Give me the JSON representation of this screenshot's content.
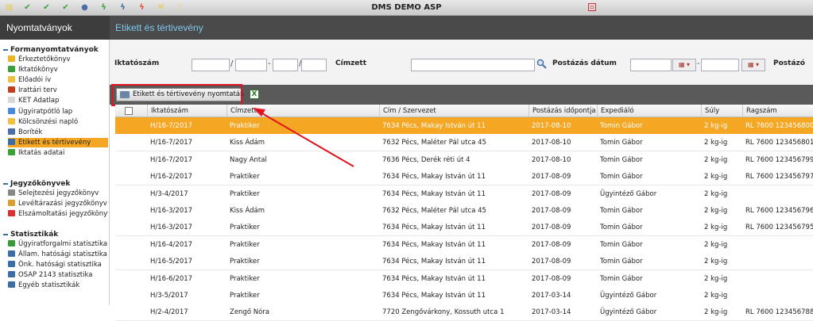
{
  "app_title": "DMS DEMO ASP",
  "sidebar_title": "Nyomtatványok",
  "page_title": "Etikett és tértivevény",
  "toolbar_icons": [
    "doc-icon",
    "check-icon",
    "check-icon",
    "check-icon",
    "user-icon",
    "lightning-icon",
    "lightning-icon",
    "lightning-icon",
    "mail-icon",
    "note-icon"
  ],
  "sections": [
    {
      "title": "Formanyomtatványok",
      "items": [
        {
          "label": "Érkeztetőkönyv",
          "icon": "book-icon",
          "color": "#f0b429"
        },
        {
          "label": "Iktatókönyv",
          "icon": "check-icon",
          "color": "#3aa03a"
        },
        {
          "label": "Előadói ív",
          "icon": "sheet-icon",
          "color": "#f0c040"
        },
        {
          "label": "Irattári terv",
          "icon": "plan-icon",
          "color": "#c04020"
        },
        {
          "label": "KET Adatlap",
          "icon": "form-icon",
          "color": "#d8d8d8"
        },
        {
          "label": "Ügyiratpótló lap",
          "icon": "page-icon",
          "color": "#4a8ad8"
        },
        {
          "label": "Kölcsönzési napló",
          "icon": "log-icon",
          "color": "#f0c040"
        },
        {
          "label": "Boríték",
          "icon": "envelope-icon",
          "color": "#4a6ea8"
        },
        {
          "label": "Etikett és tértivevény",
          "icon": "label-icon",
          "color": "#3a6ea5"
        },
        {
          "label": "Iktatás adatai",
          "icon": "check-icon",
          "color": "#3aa03a"
        }
      ]
    },
    {
      "title": "Jegyzőkönyvek",
      "items": [
        {
          "label": "Selejtezési jegyzőkönyv",
          "icon": "protocol-icon",
          "color": "#888"
        },
        {
          "label": "Levéltárazási jegyzőkönyv",
          "icon": "archive-icon",
          "color": "#d8a030"
        },
        {
          "label": "Elszámoltatási jegyzőkönyv",
          "icon": "report-icon",
          "color": "#d83030"
        }
      ]
    },
    {
      "title": "Statisztikák",
      "items": [
        {
          "label": "Ügyiratforgalmi statisztika",
          "icon": "chart-icon",
          "color": "#3a9a3a"
        },
        {
          "label": "Állam. hatósági statisztika",
          "icon": "chart-icon",
          "color": "#3a6ea5"
        },
        {
          "label": "Önk. hatósági statisztika",
          "icon": "chart-icon",
          "color": "#3a6ea5"
        },
        {
          "label": "OSAP 2143 statisztika",
          "icon": "stat-icon",
          "color": "#3a6ea5"
        },
        {
          "label": "Egyéb statisztikák",
          "icon": "stat-icon",
          "color": "#3a6ea5"
        }
      ]
    }
  ],
  "filters": {
    "iktatoszam_label": "Iktatószám",
    "cimzett_label": "Címzett",
    "postazas_label": "Postázás dátum",
    "postazo_label": "Postázó",
    "sep_slash": "/",
    "sep_dash": "-"
  },
  "toolbar": {
    "print_label": "Etikett és tértivevény nyomtatás",
    "excel_label": "X"
  },
  "columns": [
    "Iktatószám",
    "Címzett",
    "Cím / Szervezet",
    "Postázás időpontja",
    "Expediáló",
    "Súly",
    "Ragszám"
  ],
  "rows": [
    [
      "H/16-7/2017",
      "Praktiker",
      "7634 Pécs, Makay István út 11",
      "2017-08-10",
      "Tomin Gábor",
      "2 kg-ig",
      "RL 7600 123456800"
    ],
    [
      "H/16-7/2017",
      "Kiss Ádám",
      "7632 Pécs, Maléter Pál utca 45",
      "2017-08-10",
      "Tomin Gábor",
      "2 kg-ig",
      "RL 7600 123456801"
    ],
    [
      "H/16-7/2017",
      "Nagy Antal",
      "7636 Pécs, Derék réti út 4",
      "2017-08-10",
      "Tomin Gábor",
      "2 kg-ig",
      "RL 7600 123456799"
    ],
    [
      "H/16-2/2017",
      "Praktiker",
      "7634 Pécs, Makay István út 11",
      "2017-08-09",
      "Tomin Gábor",
      "2 kg-ig",
      "RL 7600 123456797"
    ],
    [
      "H/3-4/2017",
      "Praktiker",
      "7634 Pécs, Makay István út 11",
      "2017-08-09",
      "Ügyintéző Gábor",
      "2 kg-ig",
      ""
    ],
    [
      "H/16-3/2017",
      "Kiss Ádám",
      "7632 Pécs, Maléter Pál utca 45",
      "2017-08-09",
      "Tomin Gábor",
      "2 kg-ig",
      "RL 7600 123456796"
    ],
    [
      "H/16-3/2017",
      "Praktiker",
      "7634 Pécs, Makay István út 11",
      "2017-08-09",
      "Tomin Gábor",
      "2 kg-ig",
      "RL 7600 123456795"
    ],
    [
      "H/16-4/2017",
      "Praktiker",
      "7634 Pécs, Makay István út 11",
      "2017-08-09",
      "Tomin Gábor",
      "2 kg-ig",
      ""
    ],
    [
      "H/16-5/2017",
      "Praktiker",
      "7634 Pécs, Makay István út 11",
      "2017-08-09",
      "Tomin Gábor",
      "2 kg-ig",
      ""
    ],
    [
      "H/16-6/2017",
      "Praktiker",
      "7634 Pécs, Makay István út 11",
      "2017-08-09",
      "Tomin Gábor",
      "2 kg-ig",
      ""
    ],
    [
      "H/3-5/2017",
      "Praktiker",
      "7634 Pécs, Makay István út 11",
      "2017-03-14",
      "Ügyintéző Gábor",
      "2 kg-ig",
      ""
    ],
    [
      "H/2-4/2017",
      "Zengő Nóra",
      "7720 Zengővárkony, Kossuth utca 1",
      "2017-03-14",
      "Ügyintéző Gábor",
      "2 kg-ig",
      "RL 7600 123456788"
    ]
  ],
  "selected_row": 0,
  "colors": {
    "accent": "#f5a623",
    "annotation": "#e0141e",
    "header_bg": "#4a4a4a",
    "title_blue": "#7ec8ee"
  }
}
